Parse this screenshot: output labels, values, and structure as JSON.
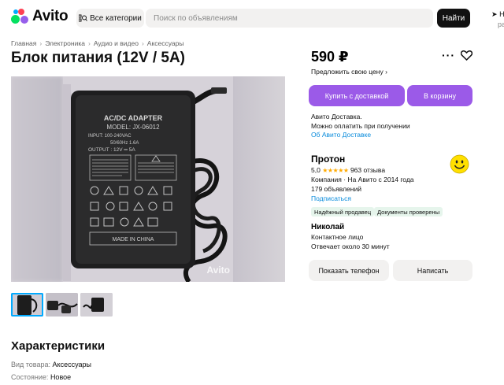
{
  "header": {
    "logo_text": "Avito",
    "categories_label": "Все категории",
    "search_placeholder": "Поиск по объявлениям",
    "search_button": "Найти",
    "location_line1": "Н",
    "location_line2": "ра"
  },
  "breadcrumbs": [
    "Главная",
    "Электроника",
    "Аудио и видео",
    "Аксессуары"
  ],
  "breadcrumb_sep": "›",
  "listing": {
    "title": "Блок питания (12V / 5A)",
    "price": "590 ₽",
    "more_label": "···",
    "offer_price": "Предложить свою цену ›",
    "buy_delivery_button": "Купить с доставкой",
    "cart_button": "В корзину",
    "delivery_line1": "Авито Доставка.",
    "delivery_line2": "Можно оплатить при получении",
    "delivery_link": "Об Авито Доставке",
    "photo_watermark": "Avito",
    "adapter_label": {
      "title": "AC/DC ADAPTER",
      "model": "MODEL: JX-06012",
      "input": "INPUT: 100-240VAC",
      "freq": "50/60Hz 1.6A",
      "output": "OUTPUT : 12V ═ 5A",
      "made_in": "MADE IN CHINA"
    }
  },
  "seller": {
    "name": "Протон",
    "rating": "5,0",
    "stars": "★★★★★",
    "reviews": "963 отзыва",
    "company_line": "Компания · На Авито с 2014 года",
    "ads_count": "179 объявлений",
    "subscribe": "Подписаться",
    "badge1": "Надёжный продавец",
    "badge2": "Документы проверены"
  },
  "contact": {
    "name": "Николай",
    "role": "Контактное лицо",
    "reply_time": "Отвечает около 30 минут",
    "show_phone_button": "Показать телефон",
    "write_button": "Написать"
  },
  "characteristics": {
    "title": "Характеристики",
    "rows": [
      {
        "key": "Вид товара:",
        "value": "Аксессуары"
      },
      {
        "key": "Состояние:",
        "value": "Новое"
      }
    ]
  },
  "colors": {
    "accent_purple": "#9b5ae8",
    "link_blue": "#0a8cdc",
    "badge_green_bg": "#e6f5ec",
    "star_orange": "#ffaa00"
  }
}
